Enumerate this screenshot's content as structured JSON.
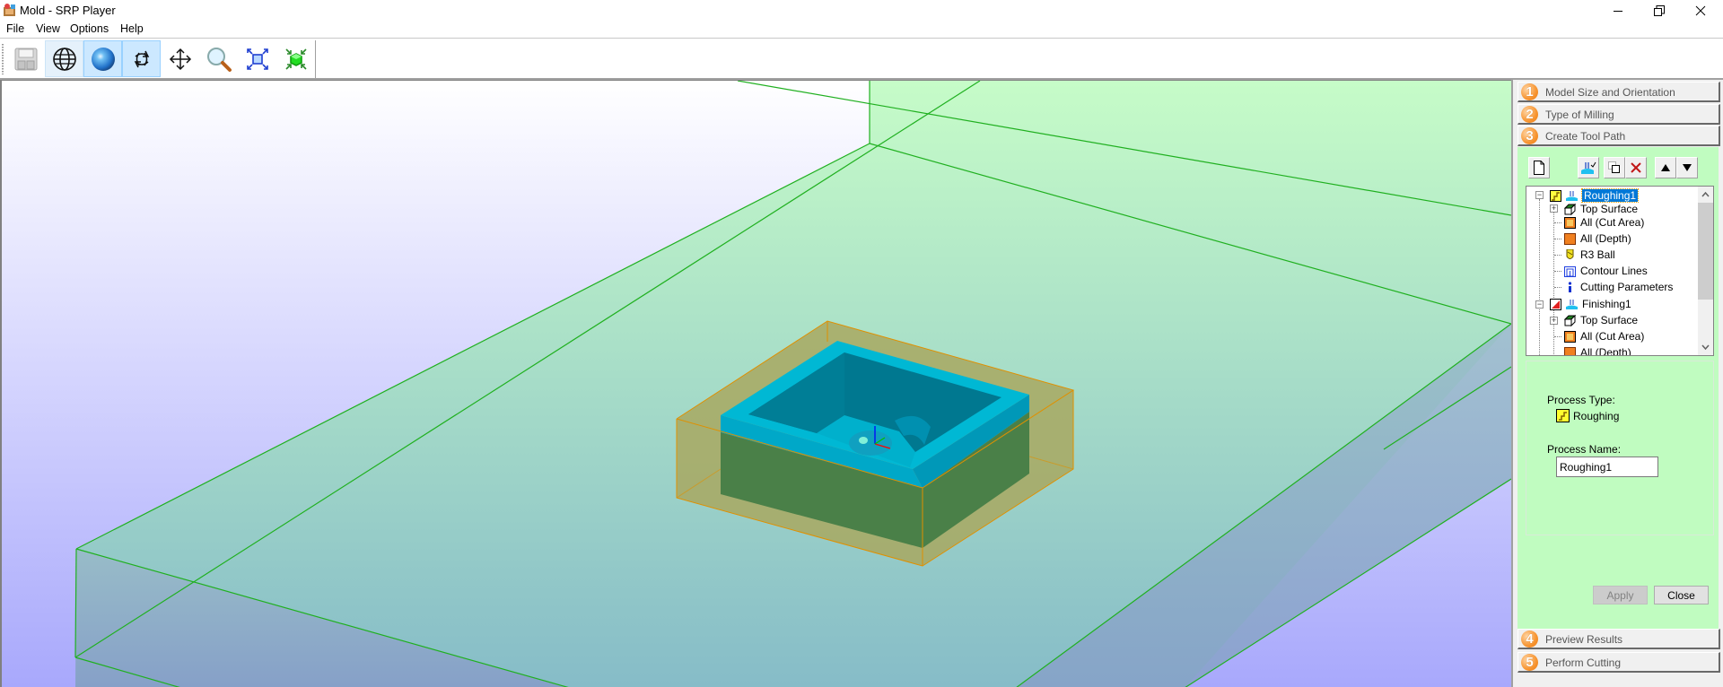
{
  "window": {
    "title": "Mold - SRP Player",
    "controls": [
      "minimize",
      "restore",
      "close"
    ]
  },
  "menu": [
    "File",
    "View",
    "Options",
    "Help"
  ],
  "toolbar": {
    "buttons": [
      {
        "name": "save",
        "icon": "floppy-disk-icon",
        "state": "disabled"
      },
      {
        "name": "wireframe-view",
        "icon": "globe-wireframe-icon",
        "state": "hover"
      },
      {
        "name": "shaded-view",
        "icon": "blue-sphere-icon",
        "state": "pressed"
      },
      {
        "name": "rotate",
        "icon": "rotate-arrows-icon",
        "state": "pressed"
      },
      {
        "name": "pan",
        "icon": "move-arrows-icon",
        "state": "normal"
      },
      {
        "name": "zoom",
        "icon": "magnifier-icon",
        "state": "normal"
      },
      {
        "name": "fit-all",
        "icon": "expand-arrows-icon",
        "state": "normal"
      },
      {
        "name": "fit-model",
        "icon": "shrink-arrows-green-cube-icon",
        "state": "normal"
      }
    ]
  },
  "panel": {
    "steps": [
      {
        "num": "1",
        "label": "Model Size and Orientation"
      },
      {
        "num": "2",
        "label": "Type of Milling"
      },
      {
        "num": "3",
        "label": "Create Tool Path"
      },
      {
        "num": "4",
        "label": "Preview Results"
      },
      {
        "num": "5",
        "label": "Perform Cutting"
      }
    ],
    "active_step": 3,
    "process_buttons": [
      "new-process",
      "calculate",
      "copy",
      "delete",
      "move-up",
      "move-down"
    ],
    "tree": [
      {
        "level": 0,
        "label": "Roughing1",
        "icon": "roughing-icon",
        "selected": true,
        "expanded": true
      },
      {
        "level": 1,
        "label": "Top Surface",
        "icon": "surface-cube-icon",
        "expandable": true
      },
      {
        "level": 1,
        "label": "All (Cut Area)",
        "icon": "cut-area-icon"
      },
      {
        "level": 1,
        "label": "All (Depth)",
        "icon": "depth-icon"
      },
      {
        "level": 1,
        "label": "R3 Ball",
        "icon": "ball-tool-icon"
      },
      {
        "level": 1,
        "label": "Contour Lines",
        "icon": "contour-lines-icon"
      },
      {
        "level": 1,
        "label": "Cutting Parameters",
        "icon": "info-icon"
      },
      {
        "level": 0,
        "label": "Finishing1",
        "icon": "finishing-icon",
        "expanded": true
      },
      {
        "level": 1,
        "label": "Top Surface",
        "icon": "surface-cube-icon",
        "expandable": true
      },
      {
        "level": 1,
        "label": "All (Cut Area)",
        "icon": "cut-area-icon"
      },
      {
        "level": 1,
        "label": "All (Depth)",
        "icon": "depth-icon"
      }
    ],
    "process_type_label": "Process Type:",
    "process_type_value": "Roughing",
    "process_name_label": "Process Name:",
    "process_name_value": "Roughing1",
    "apply_label": "Apply",
    "close_label": "Close"
  },
  "colors": {
    "panel_green": "#c0fcc0",
    "selection_blue": "#0078d7",
    "step_orange": "#f7942f",
    "stock_outline": "#20b020",
    "workpiece_outline": "#e09000",
    "model_cyan": "#00b4d0"
  }
}
